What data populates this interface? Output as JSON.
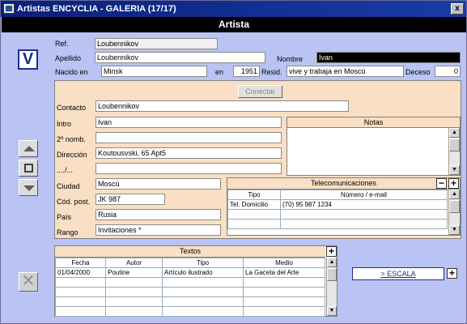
{
  "window": {
    "title": "Artistas ENCYCLIA - GALERIA (17/17)",
    "close_label": "x"
  },
  "header": {
    "title": "Artista"
  },
  "nav": {
    "v_label": "V"
  },
  "top": {
    "ref_label": "Ref.",
    "ref_value": "Loubennikov",
    "apellido_label": "Apellido",
    "apellido_value": "Loubennikov",
    "nombre_label": "Nombre",
    "nombre_value": "Ivan",
    "nacido_label": "Nacido en",
    "nacido_value": "Minsk",
    "en_label": "en",
    "en_value": "1951",
    "resid_label": "Resid.",
    "resid_value": "vive y trabaja en Moscú",
    "deceso_label": "Deceso",
    "deceso_value": "0"
  },
  "contact": {
    "conectar_label": "Conectar",
    "contacto_label": "Contacto",
    "contacto_value": "Loubennikov",
    "intro_label": "Intro",
    "intro_value": "Ivan",
    "nomb2_label": "2º nomb.",
    "nomb2_value": "",
    "direccion_label": "Dirección",
    "direccion_value": "Koutousvski, 65 Apt5",
    "dir2_label": "..../...",
    "dir2_value": "",
    "ciudad_label": "Ciudad",
    "ciudad_value": "Moscú",
    "codpost_label": "Cód. post.",
    "codpost_value": "JK 987",
    "pais_label": "País",
    "pais_value": "Rusia",
    "rango_label": "Rango",
    "rango_value": "Invitaciones *"
  },
  "notas": {
    "title": "Notas"
  },
  "telecom": {
    "title": "Telecomunicaciones",
    "minus": "−",
    "plus": "+",
    "columns": [
      "Tipo",
      "Número / e-mail"
    ],
    "rows": [
      [
        "Tel. Domicilio",
        "(70) 95 987 1234"
      ]
    ]
  },
  "textos": {
    "title": "Textos",
    "plus": "+",
    "columns": [
      "Fecha",
      "Autor",
      "Tipo",
      "Medio"
    ],
    "rows": [
      [
        "01/04/2000",
        "Poutine",
        "Artículo ilustrado",
        "La Gaceta del Arte"
      ]
    ]
  },
  "escala": {
    "label": "> ESCALA",
    "plus": "+"
  },
  "icons": [
    "app-icon",
    "close-icon",
    "v-icon",
    "arrow-up-icon",
    "square-icon",
    "arrow-down-icon",
    "delete-x-icon",
    "plus-icon",
    "minus-icon"
  ]
}
